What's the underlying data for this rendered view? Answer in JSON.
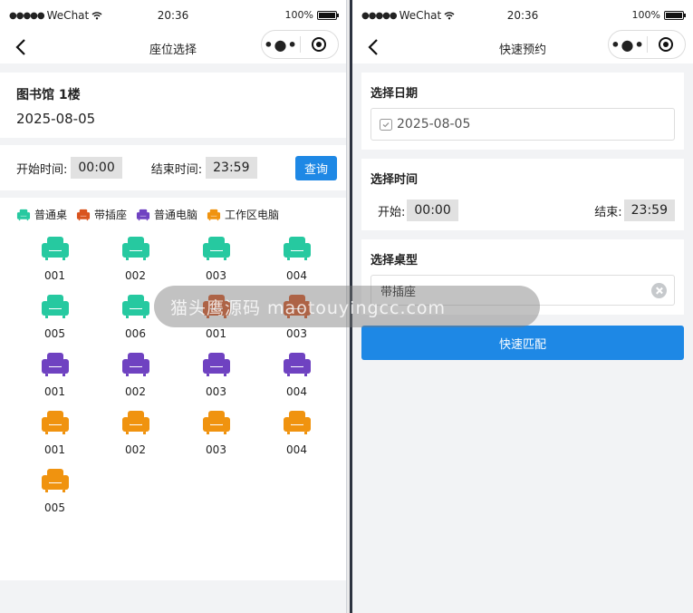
{
  "status_bar": {
    "carrier": "WeChat",
    "signal": "●●●●●",
    "time": "20:36",
    "battery": "100%"
  },
  "left": {
    "title": "座位选择",
    "library": {
      "name": "图书馆 1楼",
      "date": "2025-08-05"
    },
    "time_filter": {
      "start_label": "开始时间:",
      "start_value": "00:00",
      "end_label": "结束时间:",
      "end_value": "23:59",
      "query_label": "查询"
    },
    "legend": [
      {
        "label": "普通桌",
        "color": "#26c9a0",
        "icon": "seat-icon"
      },
      {
        "label": "带插座",
        "color": "#d9531e",
        "icon": "seat-icon"
      },
      {
        "label": "普通电脑",
        "color": "#6f42c1",
        "icon": "seat-icon"
      },
      {
        "label": "工作区电脑",
        "color": "#f0930f",
        "icon": "seat-icon"
      }
    ],
    "seats": [
      {
        "label": "001",
        "color": "#26c9a0"
      },
      {
        "label": "002",
        "color": "#26c9a0"
      },
      {
        "label": "003",
        "color": "#26c9a0"
      },
      {
        "label": "004",
        "color": "#26c9a0"
      },
      {
        "label": "005",
        "color": "#26c9a0"
      },
      {
        "label": "006",
        "color": "#26c9a0"
      },
      {
        "label": "001",
        "color": "#d9531e"
      },
      {
        "label": "003",
        "color": "#d9531e"
      },
      {
        "label": "001",
        "color": "#6f42c1"
      },
      {
        "label": "002",
        "color": "#6f42c1"
      },
      {
        "label": "003",
        "color": "#6f42c1"
      },
      {
        "label": "004",
        "color": "#6f42c1"
      },
      {
        "label": "001",
        "color": "#f0930f"
      },
      {
        "label": "002",
        "color": "#f0930f"
      },
      {
        "label": "003",
        "color": "#f0930f"
      },
      {
        "label": "004",
        "color": "#f0930f"
      },
      {
        "label": "005",
        "color": "#f0930f"
      }
    ]
  },
  "right": {
    "title": "快速预约",
    "date_section": {
      "title": "选择日期",
      "value": "2025-08-05"
    },
    "time_section": {
      "title": "选择时间",
      "start_label": "开始:",
      "start_value": "00:00",
      "end_label": "结束:",
      "end_value": "23:59"
    },
    "type_section": {
      "title": "选择桌型",
      "value": "带插座"
    },
    "match_label": "快速匹配"
  },
  "watermark": "猫头鹰源码 maotouyingcc.com",
  "colors": {
    "accent": "#1e88e5"
  }
}
